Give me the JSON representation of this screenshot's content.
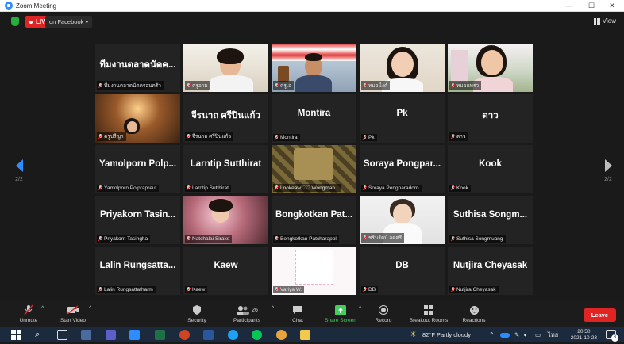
{
  "window": {
    "title": "Zoom Meeting",
    "minimize": "—",
    "maximize": "☐",
    "close": "✕"
  },
  "topbar": {
    "live_label": "LIVE",
    "stream_label": "on Facebook ▾",
    "view_label": "View"
  },
  "nav": {
    "left_page": "2/2",
    "right_page": "2/2"
  },
  "tiles": [
    {
      "big": "ทีมงานตลาดนัดค...",
      "label": "ทีมงานตลาดนัดครอบครัว",
      "video": ""
    },
    {
      "big": "",
      "label": "ครูอาม",
      "video": "v-room"
    },
    {
      "big": "",
      "label": "ครูเอ",
      "video": "v-shop"
    },
    {
      "big": "",
      "label": "หมอมิ้งค์",
      "video": "v-girl"
    },
    {
      "big": "",
      "label": "หมอแพรว",
      "video": "v-house",
      "active": true
    },
    {
      "big": "",
      "label": "ครูปรีญา",
      "video": "v-cafe"
    },
    {
      "big": "จีรนาถ ศรีปินแก้ว",
      "label": "จีรนาถ ศรีปินแก้ว",
      "video": ""
    },
    {
      "big": "Montira",
      "label": "Montira",
      "video": ""
    },
    {
      "big": "Pk",
      "label": "Pk",
      "video": ""
    },
    {
      "big": "ดาว",
      "label": "ดาว",
      "video": ""
    },
    {
      "big": "Yamolporn Polp...",
      "label": "Yamolporn Polprapreut",
      "video": ""
    },
    {
      "big": "Larntip Sutthirat",
      "label": "Larntip Sutthirat",
      "video": ""
    },
    {
      "big": "",
      "label": "Lookeaw♡♡ Wongman...",
      "video": "v-fabric"
    },
    {
      "big": "Soraya Pongpar...",
      "label": "Soraya Pongparadorn",
      "video": ""
    },
    {
      "big": "Kook",
      "label": "Kook",
      "video": ""
    },
    {
      "big": "Priyakorn Tasin...",
      "label": "Priyakorn Tasingha",
      "video": ""
    },
    {
      "big": "",
      "label": "Natchalai Sirake",
      "video": "v-flower"
    },
    {
      "big": "Bongkotkan Pat...",
      "label": "Bongkotkan Patcharapol",
      "video": ""
    },
    {
      "big": "",
      "label": "ชรินรัตน์ ลดศรี",
      "video": "v-lady"
    },
    {
      "big": "Suthisa Songm...",
      "label": "Suthisa Songmuang",
      "video": ""
    },
    {
      "big": "Lalin Rungsatta...",
      "label": "Lalin Rungsattatharm",
      "video": ""
    },
    {
      "big": "Kaew",
      "label": "Kaew",
      "video": ""
    },
    {
      "big": "",
      "label": "Variya W.",
      "video": "v-paper"
    },
    {
      "big": "DB",
      "label": "DB",
      "video": ""
    },
    {
      "big": "Nutjira Cheyasak",
      "label": "Nutjira Cheyasak",
      "video": ""
    }
  ],
  "toolbar": {
    "unmute": "Unmute",
    "start_video": "Start Video",
    "security": "Security",
    "participants": "Participants",
    "participants_count": "26",
    "chat": "Chat",
    "share_screen": "Share Screen",
    "record": "Record",
    "breakout": "Breakout Rooms",
    "reactions": "Reactions",
    "leave": "Leave"
  },
  "taskbar": {
    "weather": "82°F  Partly cloudy",
    "lang": "ไทย",
    "time": "20:50",
    "date": "2021-10-23",
    "notif_count": "3"
  },
  "colors": {
    "accent": "#2d8cff",
    "leave": "#e02424",
    "share": "#3fd15a",
    "active_border": "#d8e45a"
  }
}
